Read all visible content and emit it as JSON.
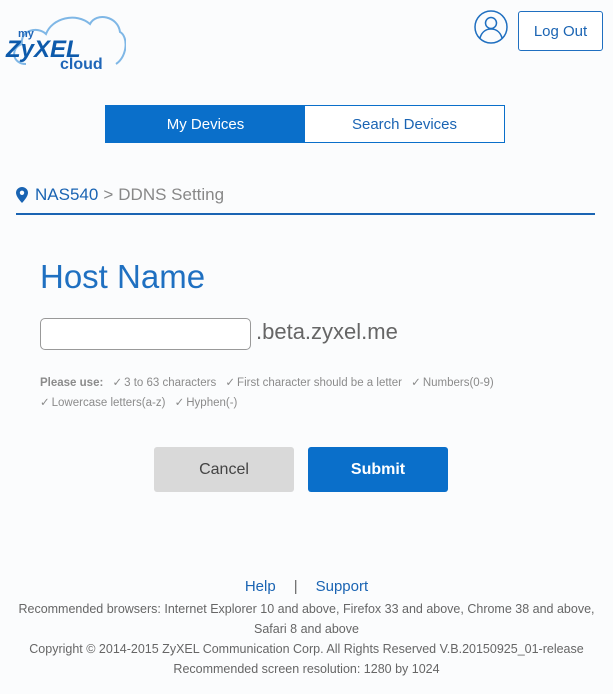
{
  "logo": {
    "my": "my",
    "zyxel": "ZyXEL",
    "cloud": "cloud"
  },
  "header": {
    "logout_label": "Log Out",
    "user_icon": "user-icon"
  },
  "tabs": [
    {
      "label": "My Devices",
      "active": true
    },
    {
      "label": "Search Devices",
      "active": false
    }
  ],
  "breadcrumb": {
    "device": "NAS540",
    "separator": ">",
    "page": "DDNS Setting",
    "icon": "location-pin-icon"
  },
  "main": {
    "title": "Host Name",
    "host_input": {
      "value": "",
      "placeholder": ""
    },
    "domain_suffix": ".beta.zyxel.me",
    "rules": {
      "label": "Please use:",
      "check": "✓",
      "items": [
        "3 to 63 characters",
        "First character should be a letter",
        "Numbers(0-9)",
        "Lowercase letters(a-z)",
        "Hyphen(-)"
      ]
    },
    "cancel_label": "Cancel",
    "submit_label": "Submit"
  },
  "footer": {
    "help": "Help",
    "separator": "|",
    "support": "Support",
    "browsers": "Recommended browsers: Internet Explorer 10 and above, Firefox 33 and above, Chrome 38 and above, Safari 8 and above",
    "copyright": "Copyright © 2014-2015 ZyXEL Communication Corp. All Rights Reserved V.B.20150925_01-release",
    "resolution": "Recommended screen resolution: 1280 by 1024"
  },
  "colors": {
    "primary": "#0a6fca",
    "link": "#1a64b3",
    "title": "#1f70c1",
    "cancel_bg": "#d9d9d9"
  }
}
